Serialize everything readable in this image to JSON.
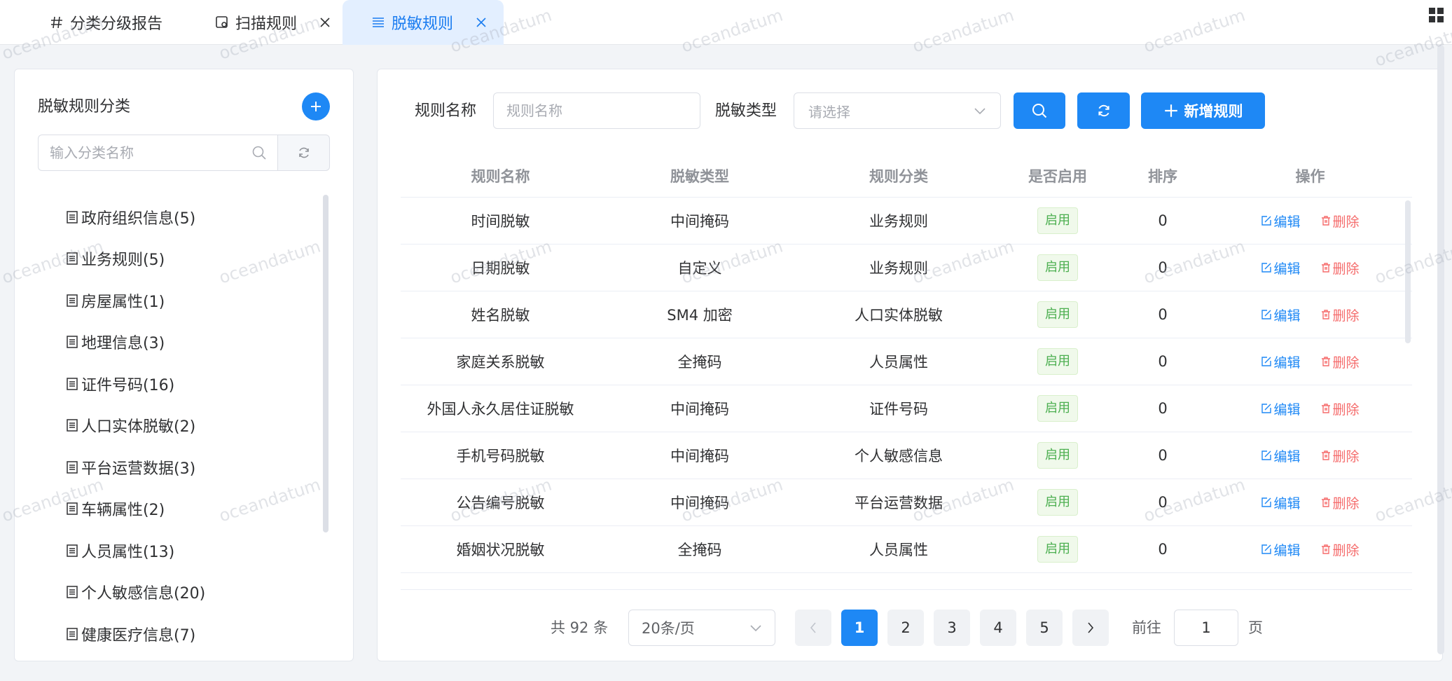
{
  "tabs": [
    {
      "label": "分类分级报告",
      "icon": "hash-icon",
      "closable": false,
      "active": false
    },
    {
      "label": "扫描规则",
      "icon": "scan-doc-icon",
      "closable": true,
      "active": false
    },
    {
      "label": "脱敏规则",
      "icon": "list-icon",
      "closable": true,
      "active": true
    }
  ],
  "sidebar": {
    "title": "脱敏规则分类",
    "search_placeholder": "输入分类名称",
    "items": [
      {
        "label": "政府组织信息(5)"
      },
      {
        "label": "业务规则(5)"
      },
      {
        "label": "房屋属性(1)"
      },
      {
        "label": "地理信息(3)"
      },
      {
        "label": "证件号码(16)"
      },
      {
        "label": "人口实体脱敏(2)"
      },
      {
        "label": "平台运营数据(3)"
      },
      {
        "label": "车辆属性(2)"
      },
      {
        "label": "人员属性(13)"
      },
      {
        "label": "个人敏感信息(20)"
      },
      {
        "label": "健康医疗信息(7)"
      }
    ]
  },
  "filters": {
    "name_label": "规则名称",
    "name_placeholder": "规则名称",
    "type_label": "脱敏类型",
    "type_placeholder": "请选择",
    "add_label": "新增规则"
  },
  "table": {
    "columns": [
      "规则名称",
      "脱敏类型",
      "规则分类",
      "是否启用",
      "排序",
      "操作"
    ],
    "edit_label": "编辑",
    "delete_label": "删除",
    "rows": [
      {
        "name": "时间脱敏",
        "type": "中间掩码",
        "category": "业务规则",
        "status": "启用",
        "order": "0"
      },
      {
        "name": "日期脱敏",
        "type": "自定义",
        "category": "业务规则",
        "status": "启用",
        "order": "0"
      },
      {
        "name": "姓名脱敏",
        "type": "SM4 加密",
        "category": "人口实体脱敏",
        "status": "启用",
        "order": "0"
      },
      {
        "name": "家庭关系脱敏",
        "type": "全掩码",
        "category": "人员属性",
        "status": "启用",
        "order": "0"
      },
      {
        "name": "外国人永久居住证脱敏",
        "type": "中间掩码",
        "category": "证件号码",
        "status": "启用",
        "order": "0"
      },
      {
        "name": "手机号码脱敏",
        "type": "中间掩码",
        "category": "个人敏感信息",
        "status": "启用",
        "order": "0"
      },
      {
        "name": "公告编号脱敏",
        "type": "中间掩码",
        "category": "平台运营数据",
        "status": "启用",
        "order": "0"
      },
      {
        "name": "婚姻状况脱敏",
        "type": "全掩码",
        "category": "人员属性",
        "status": "启用",
        "order": "0"
      }
    ]
  },
  "pagination": {
    "total": "共 92 条",
    "page_size": "20条/页",
    "pages": [
      "1",
      "2",
      "3",
      "4",
      "5"
    ],
    "current": "1",
    "goto_label": "前往",
    "goto_value": "1",
    "unit": "页"
  },
  "watermark": "oceandatum",
  "colors": {
    "primary": "#1e88f5",
    "success": "#4caf50",
    "danger": "#f56c6c"
  }
}
